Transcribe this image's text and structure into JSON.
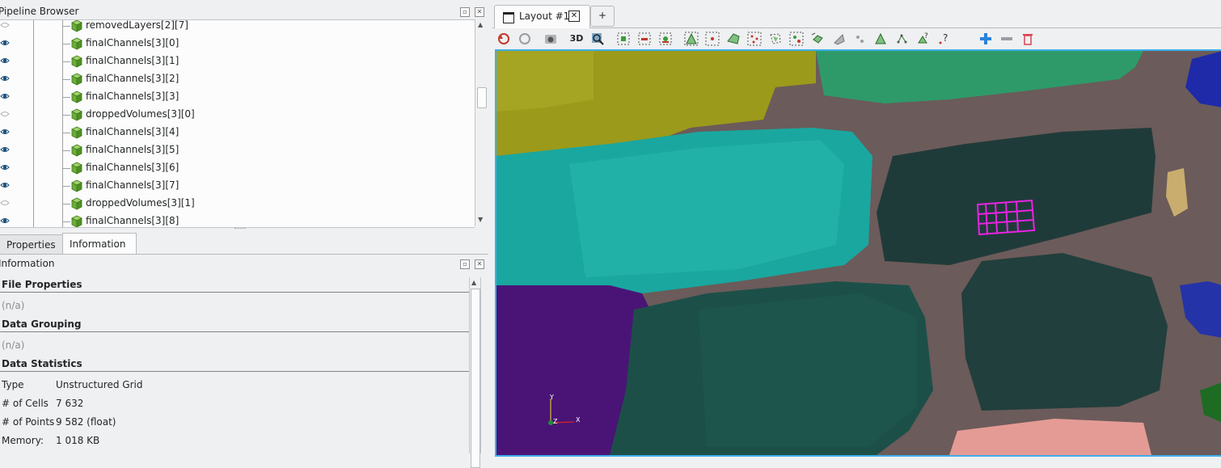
{
  "pipeline": {
    "title": "Pipeline Browser",
    "items": [
      {
        "label": "removedLayers[2][7]",
        "visible": false
      },
      {
        "label": "finalChannels[3][0]",
        "visible": true
      },
      {
        "label": "finalChannels[3][1]",
        "visible": true
      },
      {
        "label": "finalChannels[3][2]",
        "visible": true
      },
      {
        "label": "finalChannels[3][3]",
        "visible": true
      },
      {
        "label": "droppedVolumes[3][0]",
        "visible": false
      },
      {
        "label": "finalChannels[3][4]",
        "visible": true
      },
      {
        "label": "finalChannels[3][5]",
        "visible": true
      },
      {
        "label": "finalChannels[3][6]",
        "visible": true
      },
      {
        "label": "finalChannels[3][7]",
        "visible": true
      },
      {
        "label": "droppedVolumes[3][1]",
        "visible": false
      },
      {
        "label": "finalChannels[3][8]",
        "visible": true
      }
    ]
  },
  "tabs": {
    "properties": "Properties",
    "information": "Information"
  },
  "info": {
    "title": "Information",
    "file_properties": "File Properties",
    "file_properties_value": "(n/a)",
    "data_grouping": "Data Grouping",
    "data_grouping_value": "(n/a)",
    "data_statistics": "Data Statistics",
    "stats": [
      {
        "key": "Type",
        "value": "Unstructured Grid"
      },
      {
        "key": "# of Cells",
        "value": "7 632"
      },
      {
        "key": "# of Points",
        "value": "9 582 (float)"
      },
      {
        "key": "Memory:",
        "value": "1 018 KB"
      }
    ]
  },
  "layout": {
    "tab_label": "Layout #1",
    "add_tab": "+"
  },
  "toolbar": {
    "view_3d": "3D"
  },
  "axes": {
    "y": "Y",
    "z": "Z",
    "x": "X"
  }
}
